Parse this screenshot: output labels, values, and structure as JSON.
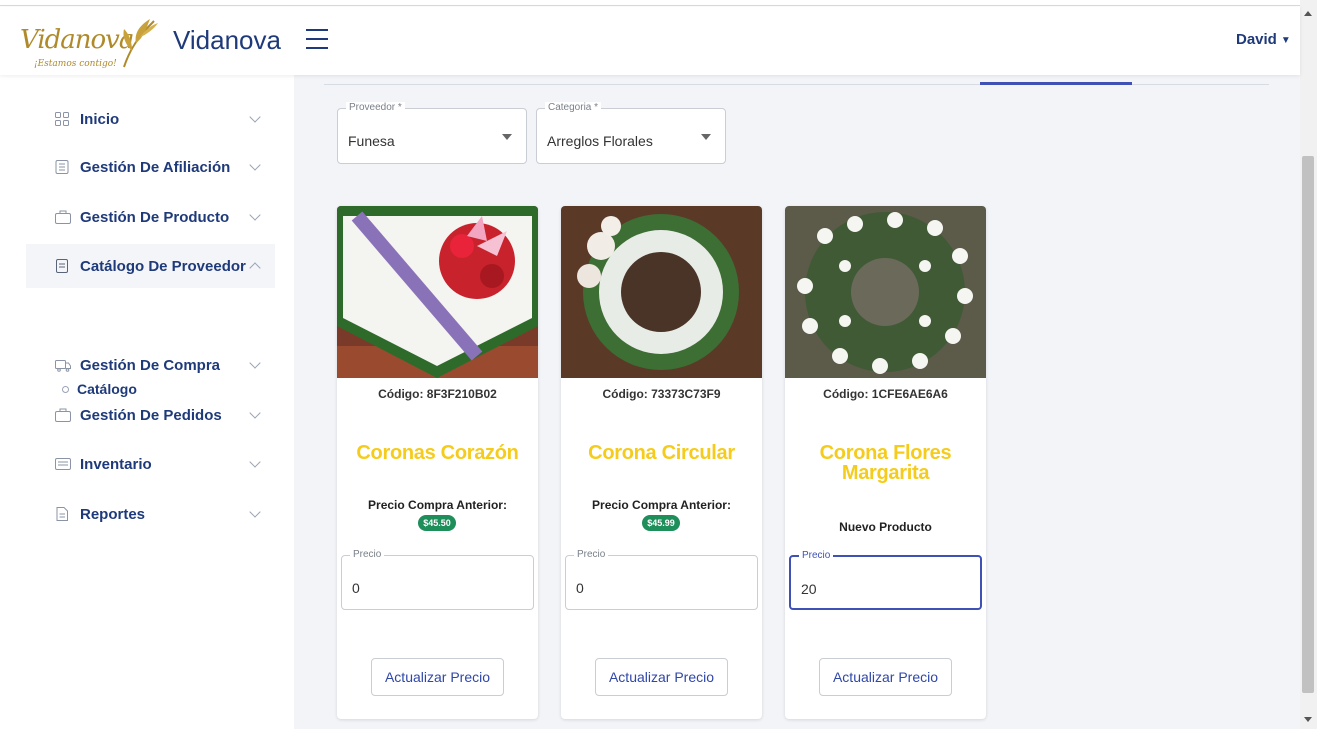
{
  "header": {
    "logo_text": "Vidanova",
    "logo_tagline": "¡Estamos contigo!",
    "brand": "Vidanova",
    "user": "David"
  },
  "sidebar": {
    "items": [
      {
        "label": "Inicio",
        "icon": "grid-icon"
      },
      {
        "label": "Gestión De Afiliación",
        "icon": "list-icon"
      },
      {
        "label": "Gestión De Producto",
        "icon": "bag-icon"
      },
      {
        "label": "Catálogo De Proveedor",
        "icon": "document-icon"
      },
      {
        "label": "Gestión De Compra",
        "icon": "truck-icon"
      },
      {
        "label": "Gestión De Pedidos",
        "icon": "bag-icon"
      },
      {
        "label": "Inventario",
        "icon": "inventory-icon"
      },
      {
        "label": "Reportes",
        "icon": "file-icon"
      }
    ],
    "sub_item": "Catálogo"
  },
  "filters": {
    "proveedor_label": "Proveedor *",
    "proveedor_value": "Funesa",
    "categoria_label": "Categoria *",
    "categoria_value": "Arreglos Florales"
  },
  "products": [
    {
      "code": "Código: 8F3F210B02",
      "name": "Coronas Corazón",
      "price_label": "Precio Compra Anterior:",
      "prev_price": "$45.50",
      "field_label": "Precio",
      "price": "0",
      "button": "Actualizar Precio"
    },
    {
      "code": "Código: 73373C73F9",
      "name": "Corona Circular",
      "price_label": "Precio Compra Anterior:",
      "prev_price": "$45.99",
      "field_label": "Precio",
      "price": "0",
      "button": "Actualizar Precio"
    },
    {
      "code": "Código: 1CFE6AE6A6",
      "name": "Corona Flores Margarita",
      "new_label": "Nuevo Producto",
      "field_label": "Precio",
      "price": "20",
      "button": "Actualizar Precio"
    }
  ],
  "colors": {
    "primary": "#1f3a7a",
    "accent": "#3f51b5",
    "product_name": "#f5cc1c",
    "badge": "#1e8e5a"
  }
}
